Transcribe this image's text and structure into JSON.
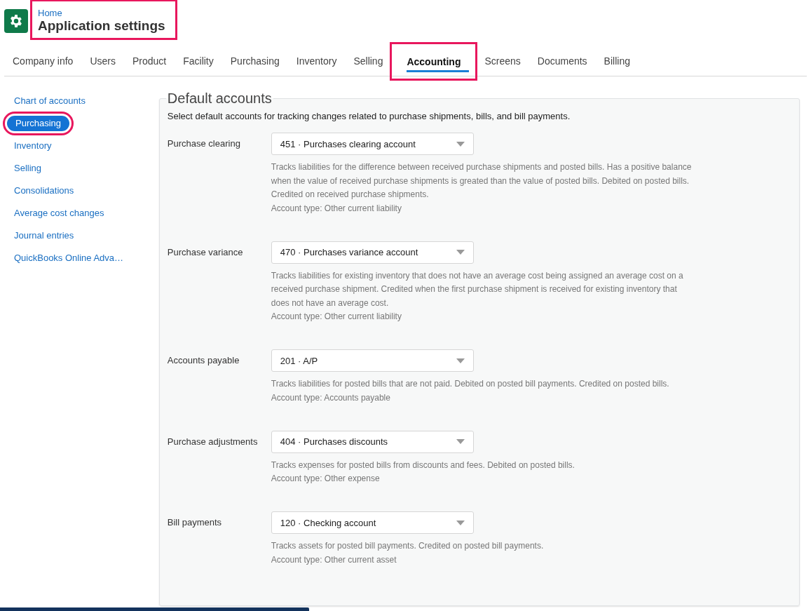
{
  "header": {
    "breadcrumb": "Home",
    "title": "Application settings",
    "highlighted": true
  },
  "tabs": [
    {
      "label": "Company info",
      "selected": false,
      "highlighted": false
    },
    {
      "label": "Users",
      "selected": false,
      "highlighted": false
    },
    {
      "label": "Product",
      "selected": false,
      "highlighted": false
    },
    {
      "label": "Facility",
      "selected": false,
      "highlighted": false
    },
    {
      "label": "Purchasing",
      "selected": false,
      "highlighted": false
    },
    {
      "label": "Inventory",
      "selected": false,
      "highlighted": false
    },
    {
      "label": "Selling",
      "selected": false,
      "highlighted": false
    },
    {
      "label": "Accounting",
      "selected": true,
      "highlighted": true
    },
    {
      "label": "Screens",
      "selected": false,
      "highlighted": false
    },
    {
      "label": "Documents",
      "selected": false,
      "highlighted": false
    },
    {
      "label": "Billing",
      "selected": false,
      "highlighted": false
    }
  ],
  "sidebar": {
    "items": [
      {
        "label": "Chart of accounts",
        "selected": false,
        "highlighted": false
      },
      {
        "label": "Purchasing",
        "selected": true,
        "highlighted": true
      },
      {
        "label": "Inventory",
        "selected": false,
        "highlighted": false
      },
      {
        "label": "Selling",
        "selected": false,
        "highlighted": false
      },
      {
        "label": "Consolidations",
        "selected": false,
        "highlighted": false
      },
      {
        "label": "Average cost changes",
        "selected": false,
        "highlighted": false
      },
      {
        "label": "Journal entries",
        "selected": false,
        "highlighted": false
      },
      {
        "label": "QuickBooks Online Adva…",
        "selected": false,
        "highlighted": false
      }
    ]
  },
  "panel": {
    "title": "Default accounts",
    "intro": "Select default accounts for tracking changes related to purchase shipments, bills, and bill payments.",
    "fields": [
      {
        "label": "Purchase clearing",
        "value": "451 · Purchases clearing account",
        "description": "Tracks liabilities for the difference between received purchase shipments and posted bills. Has a positive balance when the value of received purchase shipments is greated than the value of posted bills. Debited on posted bills. Credited on received purchase shipments.",
        "account_type": "Account type: Other current liability"
      },
      {
        "label": "Purchase variance",
        "value": "470 · Purchases variance account",
        "description": "Tracks liabilities for existing inventory that does not have an average cost being assigned an average cost on a received purchase shipment. Credited when the first purchase shipment is received for existing inventory that does not have an average cost.",
        "account_type": "Account type: Other current liability"
      },
      {
        "label": "Accounts payable",
        "value": "201 · A/P",
        "description": "Tracks liabilities for posted bills that are not paid. Debited on posted bill payments. Credited on posted bills.",
        "account_type": "Account type: Accounts payable"
      },
      {
        "label": "Purchase adjustments",
        "value": "404 · Purchases discounts",
        "description": "Tracks expenses for posted bills from discounts and fees. Debited on posted bills.",
        "account_type": "Account type: Other expense"
      },
      {
        "label": "Bill payments",
        "value": "120 · Checking account",
        "description": "Tracks assets for posted bill payments. Credited on posted bill payments.",
        "account_type": "Account type: Other current asset"
      }
    ]
  }
}
